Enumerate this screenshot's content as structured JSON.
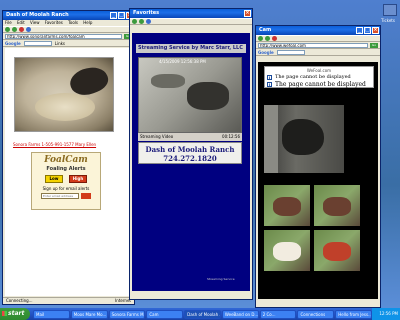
{
  "desktop": {
    "icon_label": "Tickets"
  },
  "window1": {
    "title": "Dash of Moolah Ranch",
    "menu": [
      "File",
      "Edit",
      "View",
      "Favorites",
      "Tools",
      "Help"
    ],
    "address": "http://www.sonoranfarms.com/foalcam",
    "links_label": "Links",
    "google_label": "Google",
    "caption_link": "Sonora Farms 1-505-991-1577 Mary Ellen",
    "foalcam": {
      "title": "FoalCam",
      "subtitle": "Foaling Alerts",
      "low_label": "Low",
      "high_label": "High",
      "signup": "Sign up for email alerts",
      "email_placeholder": "Enter email address"
    },
    "status": "Connecting...",
    "status_zone": "Internet"
  },
  "window2": {
    "title": "Favorites",
    "stream_title": "Streaming Service by Marc Starr, LLC",
    "cam_timestamp": "4/15/2009 12:56:38 PM",
    "player_left": "Streaming Video",
    "player_right": "00:12:56",
    "ranch_name": "Dash of Moolah Ranch",
    "ranch_phone": "724.272.1820",
    "footer_text": "Streaming Service"
  },
  "window3": {
    "title": "Cam",
    "address": "http://www.wefoal.com",
    "site_name": "WeFoal.com",
    "error_line1": "The page cannot be displayed",
    "error_line2": "The page cannot be displayed",
    "info_glyph": "i"
  },
  "taskbar": {
    "start_label": "start",
    "tasks": [
      "Mail",
      "Moos Mare Mo...",
      "Sonora Farms M...",
      "Cam",
      "Dash of Moolah ...",
      "WeeBand on D...",
      "2 Co...",
      "Connections",
      "Hello from Jess..."
    ],
    "clock": "12:56 PM"
  }
}
